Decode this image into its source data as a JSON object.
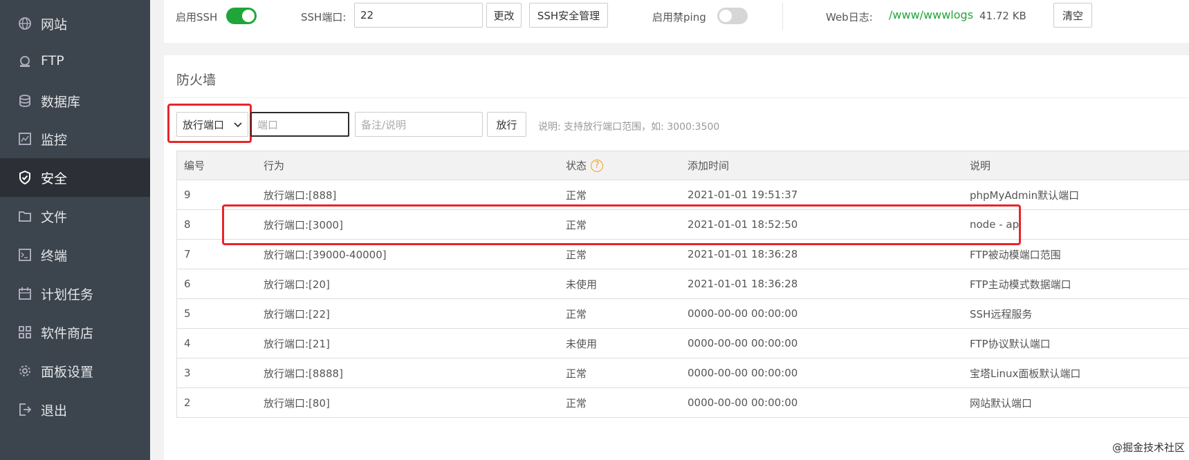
{
  "sidebar": {
    "items": [
      {
        "label": "网站",
        "icon": "globe-icon"
      },
      {
        "label": "FTP",
        "icon": "ftp-icon"
      },
      {
        "label": "数据库",
        "icon": "database-icon"
      },
      {
        "label": "监控",
        "icon": "monitor-icon"
      },
      {
        "label": "安全",
        "icon": "shield-icon",
        "active": true
      },
      {
        "label": "文件",
        "icon": "folder-icon"
      },
      {
        "label": "终端",
        "icon": "terminal-icon"
      },
      {
        "label": "计划任务",
        "icon": "calendar-icon"
      },
      {
        "label": "软件商店",
        "icon": "grid-icon"
      },
      {
        "label": "面板设置",
        "icon": "gear-icon"
      },
      {
        "label": "退出",
        "icon": "logout-icon"
      }
    ]
  },
  "top": {
    "ssh_label": "启用SSH",
    "ssh_enabled": true,
    "ssh_port_label": "SSH端口:",
    "ssh_port_value": "22",
    "change_button": "更改",
    "ssh_manage_button": "SSH安全管理",
    "ping_label": "启用禁ping",
    "ping_enabled": false,
    "weblog_label": "Web日志:",
    "weblog_path": "/www/wwwlogs",
    "weblog_size": "41.72 KB",
    "clear_button": "清空"
  },
  "firewall": {
    "title": "防火墙",
    "action_select": "放行端口",
    "port_placeholder": "端口",
    "note_placeholder": "备注/说明",
    "allow_button": "放行",
    "hint": "说明: 支持放行端口范围，如: 3000:3500",
    "columns": [
      "编号",
      "行为",
      "状态",
      "添加时间",
      "说明"
    ],
    "rows": [
      {
        "id": "9",
        "action": "放行端口:[888]",
        "status": "正常",
        "time": "2021-01-01 19:51:37",
        "note": "phpMyAdmin默认端口"
      },
      {
        "id": "8",
        "action": "放行端口:[3000]",
        "status": "正常",
        "time": "2021-01-01 18:52:50",
        "note": "node - api"
      },
      {
        "id": "7",
        "action": "放行端口:[39000-40000]",
        "status": "正常",
        "time": "2021-01-01 18:36:28",
        "note": "FTP被动模端口范围"
      },
      {
        "id": "6",
        "action": "放行端口:[20]",
        "status": "未使用",
        "time": "2021-01-01 18:36:28",
        "note": "FTP主动模式数据端口"
      },
      {
        "id": "5",
        "action": "放行端口:[22]",
        "status": "正常",
        "time": "0000-00-00 00:00:00",
        "note": "SSH远程服务"
      },
      {
        "id": "4",
        "action": "放行端口:[21]",
        "status": "未使用",
        "time": "0000-00-00 00:00:00",
        "note": "FTP协议默认端口"
      },
      {
        "id": "3",
        "action": "放行端口:[8888]",
        "status": "正常",
        "time": "0000-00-00 00:00:00",
        "note": "宝塔Linux面板默认端口"
      },
      {
        "id": "2",
        "action": "放行端口:[80]",
        "status": "正常",
        "time": "0000-00-00 00:00:00",
        "note": "网站默认端口"
      }
    ]
  },
  "watermark": "@掘金技术社区",
  "colors": {
    "sidebar": "#3c444d",
    "accent": "#20a53a",
    "highlight": "#e8242a"
  }
}
